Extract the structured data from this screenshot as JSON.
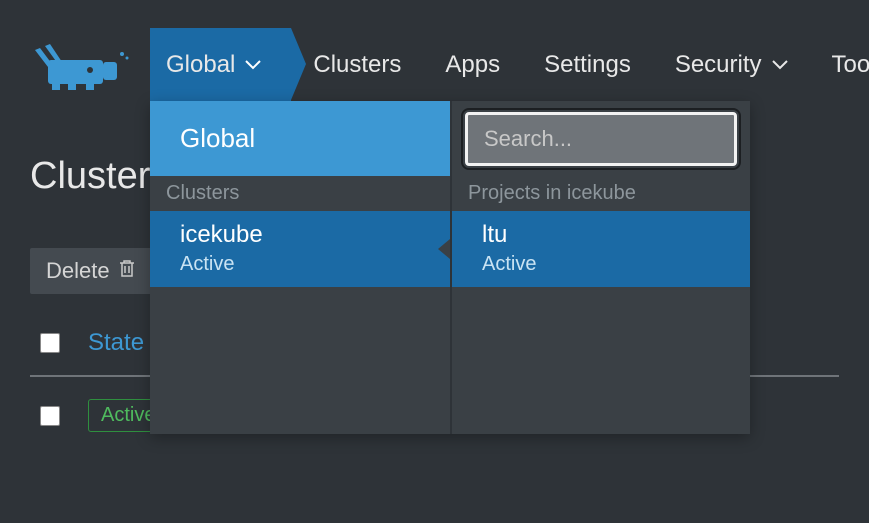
{
  "nav": {
    "scope": "Global",
    "items": [
      "Clusters",
      "Apps",
      "Settings",
      "Security",
      "Tools"
    ]
  },
  "page": {
    "title": "Clusters",
    "delete_label": "Delete",
    "columns": {
      "state": "State"
    },
    "rows": [
      {
        "state": "Active"
      }
    ]
  },
  "dropdown": {
    "global_label": "Global",
    "clusters_label": "Clusters",
    "projects_label": "Projects in icekube",
    "search_placeholder": "Search...",
    "clusters": [
      {
        "name": "icekube",
        "status": "Active"
      }
    ],
    "projects": [
      {
        "name": "ltu",
        "status": "Active"
      }
    ]
  }
}
